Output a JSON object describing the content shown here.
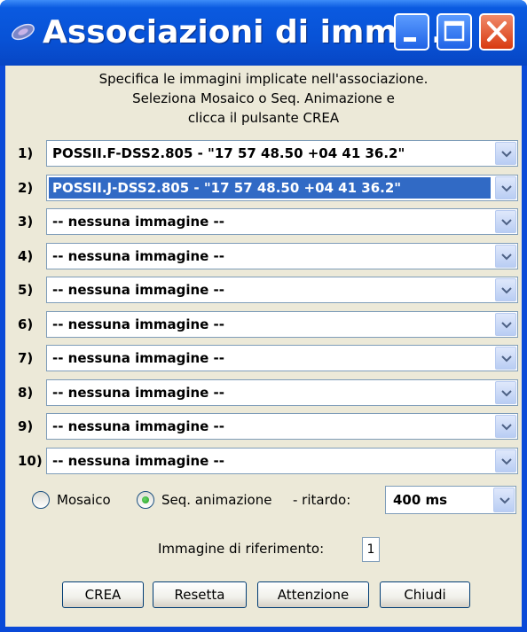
{
  "window": {
    "title": "Associazioni di imma...",
    "controls": {
      "minimize": "minimize-icon",
      "maximize": "maximize-icon",
      "close": "close-icon"
    }
  },
  "instructions": [
    "Specifica le immagini implicate nell'associazione.",
    "Seleziona Mosaico o Seq. Animazione e",
    "clicca il pulsante CREA"
  ],
  "rows": [
    {
      "label": "1)",
      "value": "POSSII.F-DSS2.805 - \"17 57 48.50 +04 41 36.2\"",
      "selected": false
    },
    {
      "label": "2)",
      "value": "POSSII.J-DSS2.805 - \"17 57 48.50 +04 41 36.2\"",
      "selected": true
    },
    {
      "label": "3)",
      "value": "-- nessuna immagine --",
      "selected": false
    },
    {
      "label": "4)",
      "value": "-- nessuna immagine --",
      "selected": false
    },
    {
      "label": "5)",
      "value": "-- nessuna immagine --",
      "selected": false
    },
    {
      "label": "6)",
      "value": "-- nessuna immagine --",
      "selected": false
    },
    {
      "label": "7)",
      "value": "-- nessuna immagine --",
      "selected": false
    },
    {
      "label": "8)",
      "value": "-- nessuna immagine --",
      "selected": false
    },
    {
      "label": "9)",
      "value": "-- nessuna immagine --",
      "selected": false
    },
    {
      "label": "10)",
      "value": "-- nessuna immagine --",
      "selected": false
    }
  ],
  "mode": {
    "mosaic_label": "Mosaico",
    "animation_label": "Seq. animazione",
    "selected": "animation",
    "delay_label": "- ritardo:",
    "delay_value": "400 ms"
  },
  "reference": {
    "label": "Immagine di riferimento:",
    "value": "1"
  },
  "buttons": {
    "create": "CREA",
    "reset": "Resetta",
    "attention": "Attenzione",
    "close": "Chiudi"
  },
  "colors": {
    "titlebar": "#0852d6",
    "client_bg": "#ece9d8",
    "selection": "#316ac5",
    "close_button": "#d83a10"
  }
}
